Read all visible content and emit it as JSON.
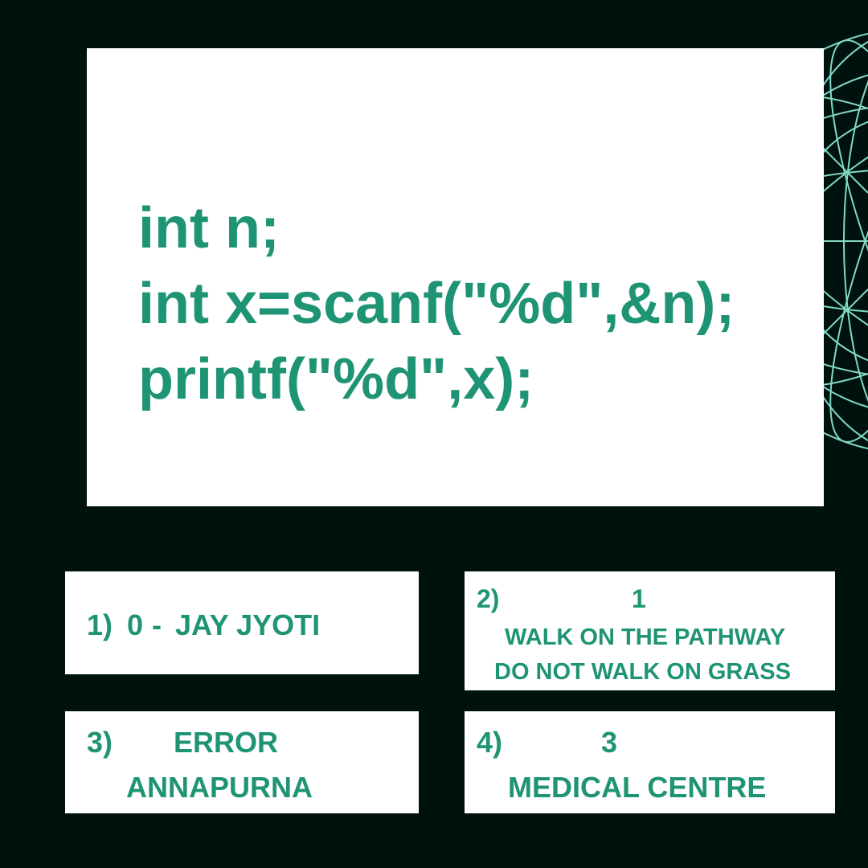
{
  "code": {
    "lines": [
      "int n;",
      "int x=scanf(\"%d\",&n);",
      "printf(\"%d\",x);"
    ]
  },
  "options": [
    {
      "number": "1)",
      "answer": "0",
      "separator": "-",
      "tag": "JAY JYOTI"
    },
    {
      "number": "2)",
      "answer": "1",
      "tag_line1": "WALK ON THE PATHWAY",
      "tag_line2": "DO NOT WALK ON GRASS"
    },
    {
      "number": "3)",
      "answer": "ERROR",
      "tag": "ANNAPURNA"
    },
    {
      "number": "4)",
      "answer": "3",
      "tag": "MEDICAL CENTRE"
    }
  ],
  "colors": {
    "background": "#00120d",
    "text_accent": "#1f9474",
    "globe_lines": "#8ff0dc",
    "card": "#ffffff"
  },
  "icons": {
    "decoration": "wireframe-globe-icon"
  }
}
